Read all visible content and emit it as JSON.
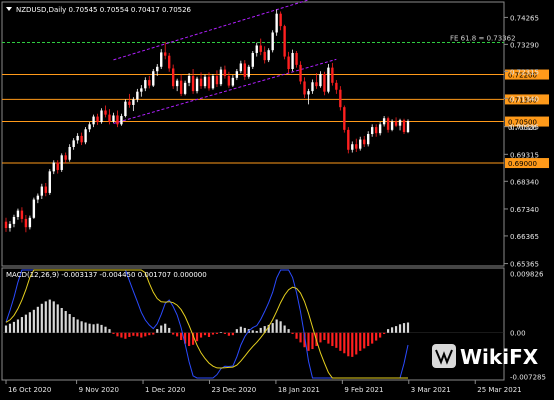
{
  "chart_data": {
    "type": "candlestick",
    "header": "NZDUSD,Daily  0.70545 0.70554 0.70417 0.70526",
    "price_axis_ticks": [
      0.74265,
      0.7329,
      0.72315,
      0.7134,
      0.70315,
      0.69315,
      0.6834,
      0.6734,
      0.66365,
      0.65365
    ],
    "price_ylim": [
      0.6535,
      0.7475
    ],
    "levels": [
      {
        "value": 0.7336,
        "label": "FE 61.8 = 0.73362",
        "style": "dashed",
        "color": "#2ecc40"
      },
      {
        "value": 0.722,
        "label": "0.72200",
        "style": "solid",
        "color": "#ff9a1a"
      },
      {
        "value": 0.713,
        "label": "0.71300",
        "style": "solid",
        "color": "#ff9a1a"
      },
      {
        "value": 0.705,
        "label": "0.70500",
        "style": "solid",
        "color": "#ff9a1a"
      },
      {
        "value": 0.69,
        "label": "0.69000",
        "style": "solid",
        "color": "#ff9a1a"
      }
    ],
    "current_price_label": "0.70526",
    "channel_upper": [
      [
        27,
        0.7273
      ],
      [
        76,
        0.749
      ]
    ],
    "channel_lower": [
      [
        27,
        0.7043
      ],
      [
        83,
        0.7275
      ]
    ],
    "candles": [
      [
        0.6688,
        0.6702,
        0.6651,
        0.6665
      ],
      [
        0.6665,
        0.669,
        0.6652,
        0.668
      ],
      [
        0.668,
        0.6713,
        0.6668,
        0.6705
      ],
      [
        0.6705,
        0.6735,
        0.6695,
        0.6728
      ],
      [
        0.6728,
        0.674,
        0.6685,
        0.6698
      ],
      [
        0.6698,
        0.6712,
        0.665,
        0.6668
      ],
      [
        0.6668,
        0.671,
        0.666,
        0.6702
      ],
      [
        0.6702,
        0.6775,
        0.6698,
        0.6768
      ],
      [
        0.6768,
        0.679,
        0.6755,
        0.6782
      ],
      [
        0.6782,
        0.6825,
        0.677,
        0.6815
      ],
      [
        0.6815,
        0.6828,
        0.678,
        0.6792
      ],
      [
        0.6792,
        0.6878,
        0.6785,
        0.687
      ],
      [
        0.687,
        0.691,
        0.686,
        0.6902
      ],
      [
        0.6902,
        0.691,
        0.6862,
        0.6875
      ],
      [
        0.6875,
        0.6935,
        0.6868,
        0.6928
      ],
      [
        0.6928,
        0.6938,
        0.69,
        0.6912
      ],
      [
        0.6912,
        0.6968,
        0.6905,
        0.6958
      ],
      [
        0.6958,
        0.699,
        0.6948,
        0.6982
      ],
      [
        0.6982,
        0.7008,
        0.697,
        0.6998
      ],
      [
        0.6998,
        0.701,
        0.6965,
        0.6975
      ],
      [
        0.6975,
        0.703,
        0.6968,
        0.7022
      ],
      [
        0.7022,
        0.7048,
        0.7012,
        0.704
      ],
      [
        0.704,
        0.7075,
        0.703,
        0.7068
      ],
      [
        0.7068,
        0.7078,
        0.7038,
        0.7048
      ],
      [
        0.7048,
        0.7098,
        0.7042,
        0.709
      ],
      [
        0.709,
        0.7108,
        0.7065,
        0.7075
      ],
      [
        0.7075,
        0.7095,
        0.704,
        0.705
      ],
      [
        0.705,
        0.7082,
        0.7045,
        0.7072
      ],
      [
        0.7072,
        0.709,
        0.703,
        0.704
      ],
      [
        0.704,
        0.7078,
        0.7035,
        0.707
      ],
      [
        0.707,
        0.713,
        0.7065,
        0.7122
      ],
      [
        0.7122,
        0.715,
        0.71,
        0.711
      ],
      [
        0.711,
        0.7138,
        0.7088,
        0.713
      ],
      [
        0.713,
        0.7168,
        0.712,
        0.7158
      ],
      [
        0.7158,
        0.7182,
        0.714,
        0.717
      ],
      [
        0.717,
        0.721,
        0.716,
        0.72
      ],
      [
        0.72,
        0.7215,
        0.717,
        0.718
      ],
      [
        0.718,
        0.724,
        0.7175,
        0.7232
      ],
      [
        0.7232,
        0.7258,
        0.7215,
        0.7248
      ],
      [
        0.7248,
        0.7312,
        0.724,
        0.73
      ],
      [
        0.73,
        0.7338,
        0.7275,
        0.7288
      ],
      [
        0.7288,
        0.7298,
        0.723,
        0.7242
      ],
      [
        0.7242,
        0.7256,
        0.7168,
        0.7178
      ],
      [
        0.7178,
        0.7205,
        0.716,
        0.7198
      ],
      [
        0.7198,
        0.722,
        0.7142,
        0.715
      ],
      [
        0.715,
        0.7198,
        0.7145,
        0.719
      ],
      [
        0.719,
        0.7225,
        0.7178,
        0.7215
      ],
      [
        0.7215,
        0.724,
        0.715,
        0.716
      ],
      [
        0.716,
        0.7212,
        0.7152,
        0.7205
      ],
      [
        0.7205,
        0.7228,
        0.7168,
        0.7178
      ],
      [
        0.7178,
        0.722,
        0.717,
        0.7212
      ],
      [
        0.7212,
        0.7228,
        0.7162,
        0.717
      ],
      [
        0.717,
        0.7222,
        0.7165,
        0.7215
      ],
      [
        0.7215,
        0.7235,
        0.7175,
        0.7185
      ],
      [
        0.7185,
        0.7248,
        0.7178,
        0.7238
      ],
      [
        0.7238,
        0.7252,
        0.7205,
        0.7215
      ],
      [
        0.7215,
        0.723,
        0.7172,
        0.718
      ],
      [
        0.718,
        0.7218,
        0.7175,
        0.7208
      ],
      [
        0.7208,
        0.724,
        0.72,
        0.7232
      ],
      [
        0.7232,
        0.727,
        0.7225,
        0.726
      ],
      [
        0.726,
        0.7272,
        0.72,
        0.7212
      ],
      [
        0.7212,
        0.7255,
        0.7205,
        0.7248
      ],
      [
        0.7248,
        0.7305,
        0.724,
        0.7298
      ],
      [
        0.7298,
        0.7335,
        0.7285,
        0.7325
      ],
      [
        0.7325,
        0.735,
        0.729,
        0.7302
      ],
      [
        0.7302,
        0.7322,
        0.726,
        0.7272
      ],
      [
        0.7272,
        0.7315,
        0.7265,
        0.7308
      ],
      [
        0.7308,
        0.738,
        0.73,
        0.7372
      ],
      [
        0.7372,
        0.7455,
        0.736,
        0.744
      ],
      [
        0.744,
        0.7448,
        0.738,
        0.7395
      ],
      [
        0.7395,
        0.74,
        0.7275,
        0.7285
      ],
      [
        0.7285,
        0.7302,
        0.7225,
        0.724
      ],
      [
        0.724,
        0.731,
        0.7232,
        0.7298
      ],
      [
        0.7298,
        0.7305,
        0.7245,
        0.7255
      ],
      [
        0.7255,
        0.7268,
        0.7185,
        0.7195
      ],
      [
        0.7195,
        0.721,
        0.7135,
        0.7148
      ],
      [
        0.7148,
        0.7168,
        0.7112,
        0.716
      ],
      [
        0.716,
        0.7202,
        0.715,
        0.7192
      ],
      [
        0.7192,
        0.7225,
        0.7168,
        0.7178
      ],
      [
        0.7178,
        0.7232,
        0.7172,
        0.7222
      ],
      [
        0.7222,
        0.723,
        0.7145,
        0.7158
      ],
      [
        0.7158,
        0.7258,
        0.7152,
        0.7245
      ],
      [
        0.7245,
        0.7262,
        0.718,
        0.719
      ],
      [
        0.719,
        0.72,
        0.715,
        0.7165
      ],
      [
        0.7165,
        0.7178,
        0.709,
        0.7102
      ],
      [
        0.7102,
        0.7108,
        0.701,
        0.702
      ],
      [
        0.702,
        0.703,
        0.6935,
        0.6948
      ],
      [
        0.6948,
        0.6978,
        0.6938,
        0.6968
      ],
      [
        0.6968,
        0.6988,
        0.694,
        0.6952
      ],
      [
        0.6952,
        0.6995,
        0.6945,
        0.6985
      ],
      [
        0.6985,
        0.6998,
        0.6958,
        0.6968
      ],
      [
        0.6968,
        0.7015,
        0.696,
        0.7005
      ],
      [
        0.7005,
        0.704,
        0.6995,
        0.703
      ],
      [
        0.703,
        0.704,
        0.6995,
        0.7008
      ],
      [
        0.7008,
        0.7048,
        0.7,
        0.704
      ],
      [
        0.704,
        0.707,
        0.7032,
        0.7062
      ],
      [
        0.7062,
        0.7068,
        0.701,
        0.702
      ],
      [
        0.702,
        0.7058,
        0.7015,
        0.705
      ],
      [
        0.705,
        0.7065,
        0.703,
        0.7035
      ],
      [
        0.7035,
        0.706,
        0.7018,
        0.7055
      ],
      [
        0.7055,
        0.706,
        0.7005,
        0.7012
      ],
      [
        0.7012,
        0.7058,
        0.7008,
        0.7052
      ]
    ],
    "macd": {
      "label": "MACD(12,26,9) -0.003137 -0.004450 0.001707 0.000000",
      "axis_ticks": [
        0.009826,
        0.0,
        -0.007285
      ],
      "ylim": [
        -0.0075,
        0.0104
      ],
      "histogram": [
        0.0012,
        0.0015,
        0.0018,
        0.0022,
        0.0026,
        0.003,
        0.0034,
        0.0038,
        0.0043,
        0.0048,
        0.0052,
        0.0055,
        0.0052,
        0.0047,
        0.0041,
        0.0036,
        0.0031,
        0.0026,
        0.0022,
        0.0019,
        0.0017,
        0.0015,
        0.0014,
        0.0015,
        0.0013,
        0.001,
        0.0006,
        -0.0002,
        -0.0006,
        -0.0008,
        -0.001,
        -0.0007,
        -0.0005,
        -0.0006,
        -0.0008,
        -0.0006,
        -0.0004,
        -0.0003,
        0.0006,
        0.0012,
        0.0015,
        0.0008,
        -0.0003,
        -0.0006,
        -0.0012,
        -0.0018,
        -0.0022,
        -0.002,
        -0.0014,
        -0.0008,
        -0.0004,
        -0.0007,
        -0.0003,
        -0.0002,
        0.0001,
        -0.0002,
        -0.0005,
        -0.0004,
        0.0006,
        0.001,
        0.0008,
        0.0006,
        0.0004,
        0.0003,
        0.0008,
        0.0011,
        0.0013,
        0.0016,
        0.0022,
        0.0019,
        0.0012,
        0.0006,
        -0.0002,
        -0.001,
        -0.0016,
        -0.0024,
        -0.003,
        -0.0027,
        -0.0022,
        -0.0016,
        -0.0012,
        -0.0018,
        -0.0022,
        -0.0025,
        -0.003,
        -0.0034,
        -0.0039,
        -0.004,
        -0.0036,
        -0.003,
        -0.0026,
        -0.0022,
        -0.0018,
        -0.0013,
        -0.0008,
        -0.0002,
        0.0006,
        0.0009,
        0.0011,
        0.0014,
        0.0016,
        0.0017
      ],
      "signal_color": "#e6d01e",
      "macd_color": "#2b4bff"
    },
    "time_labels": [
      {
        "label": "16 Oct 2020",
        "i": 0
      },
      {
        "label": "9 Nov 2020",
        "i": 17
      },
      {
        "label": "1 Dec 2020",
        "i": 33
      },
      {
        "label": "23 Dec 2020",
        "i": 49
      },
      {
        "label": "18 Jan 2021",
        "i": 65
      },
      {
        "label": "9 Feb 2021",
        "i": 81
      },
      {
        "label": "3 Mar 2021",
        "i": 97
      },
      {
        "label": "25 Mar 2021",
        "i": 113
      }
    ],
    "bull_color": "#ffffff",
    "bear_color": "#ff2020",
    "channel_color": "#b020ff",
    "grid": false
  },
  "watermark": {
    "text": "WikiFX"
  }
}
